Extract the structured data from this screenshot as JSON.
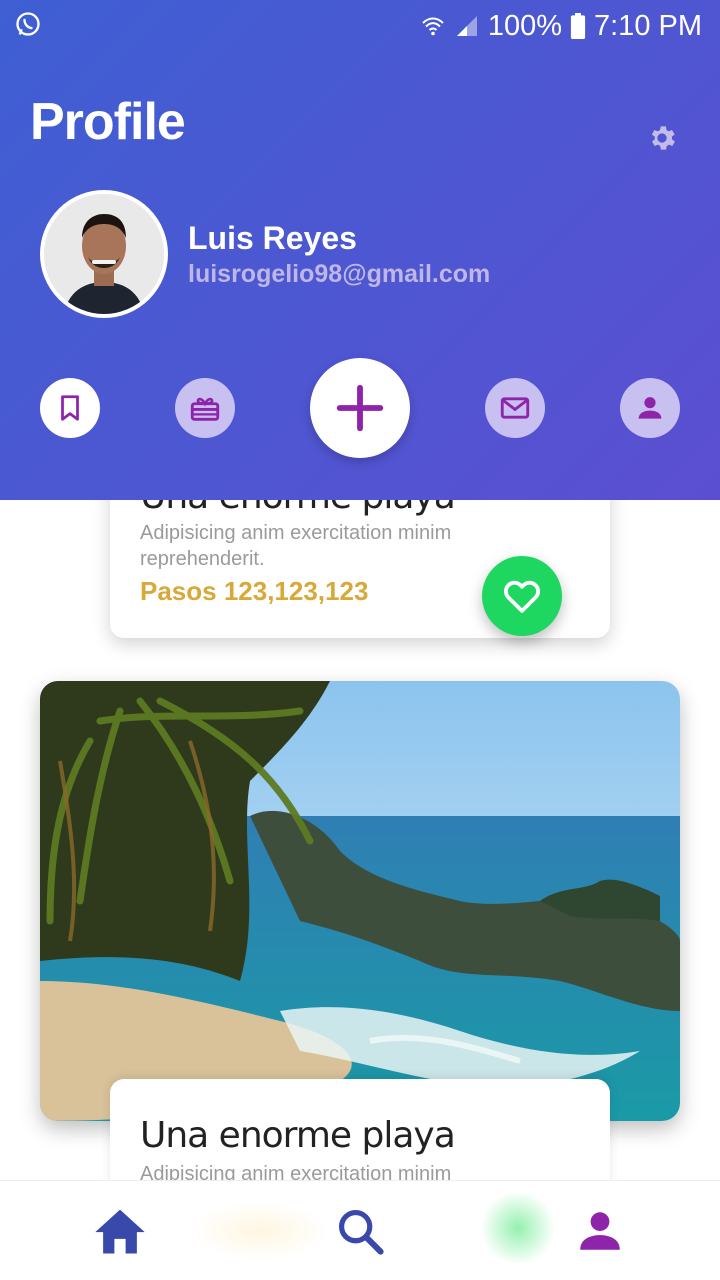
{
  "status_bar": {
    "battery": "100%",
    "time": "7:10 PM"
  },
  "header": {
    "title": "Profile"
  },
  "profile": {
    "name": "Luis Reyes",
    "email": "luisrogelio98@gmail.com"
  },
  "actions": [
    {
      "icon": "bookmark-icon"
    },
    {
      "icon": "gift-icon"
    },
    {
      "icon": "plus-icon"
    },
    {
      "icon": "mail-icon"
    },
    {
      "icon": "person-icon"
    }
  ],
  "cards": [
    {
      "title": "Una enorme playa",
      "description": "Adipisicing anim exercitation minim reprehenderit.",
      "steps": "Pasos 123,123,123"
    },
    {
      "title": "Una enorme playa",
      "description": "Adipisicing anim exercitation minim"
    }
  ],
  "bottom_nav": [
    {
      "icon": "home-icon"
    },
    {
      "icon": "search-icon"
    },
    {
      "icon": "person-icon"
    }
  ],
  "colors": {
    "header_start": "#3f5fd3",
    "header_end": "#5b4fd1",
    "accent_purple": "#8e24aa",
    "nav_blue": "#3949ab",
    "favorite_green": "#1ed760",
    "steps_gold": "#d8a838"
  }
}
